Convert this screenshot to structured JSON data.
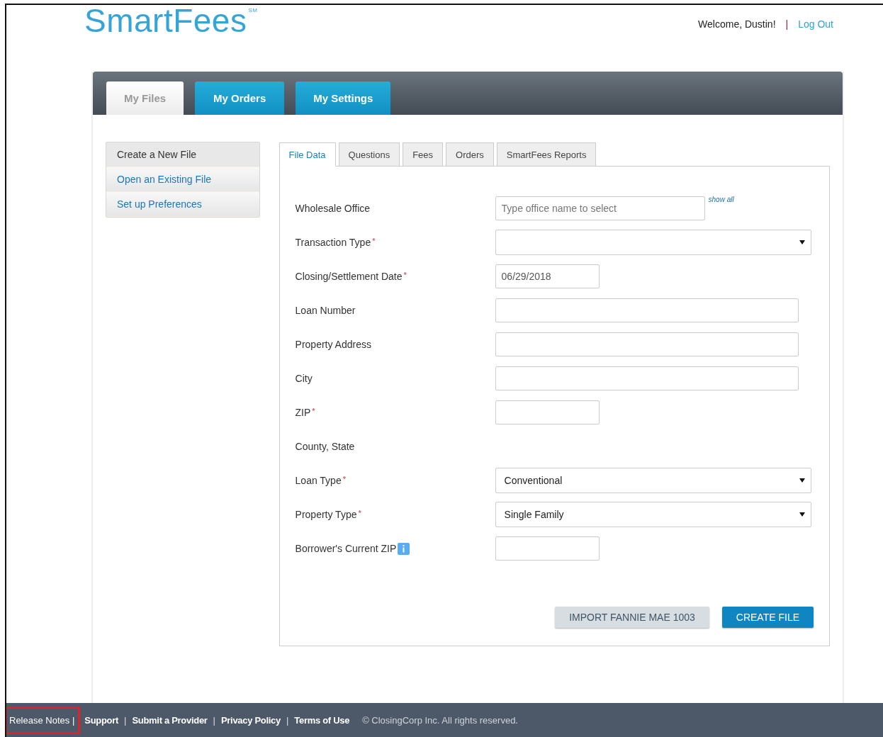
{
  "header": {
    "logo": "SmartFees",
    "logo_mark": "SM",
    "welcome": "Welcome, Dustin!",
    "separator": "|",
    "logout": "Log Out"
  },
  "main_tabs": [
    {
      "label": "My Files",
      "selected": true
    },
    {
      "label": "My Orders",
      "selected": false
    },
    {
      "label": "My Settings",
      "selected": false
    }
  ],
  "sidebar": {
    "items": [
      {
        "label": "Create a New File",
        "selected": true
      },
      {
        "label": "Open an Existing File",
        "selected": false
      },
      {
        "label": "Set up Preferences",
        "selected": false
      }
    ]
  },
  "sub_tabs": [
    {
      "label": "File Data",
      "selected": true
    },
    {
      "label": "Questions",
      "selected": false
    },
    {
      "label": "Fees",
      "selected": false
    },
    {
      "label": "Orders",
      "selected": false
    },
    {
      "label": "SmartFees Reports",
      "selected": false
    }
  ],
  "form": {
    "fields": [
      {
        "label": "Wholesale Office",
        "kind": "search",
        "placeholder": "Type office name to select",
        "link": "show all"
      },
      {
        "label": "Transaction Type",
        "required_mark": "*",
        "kind": "select"
      },
      {
        "label": "Closing/Settlement Date",
        "required_mark": "*",
        "kind": "date",
        "value": "06/29/2018"
      },
      {
        "label": "Loan Number",
        "kind": "text"
      },
      {
        "label": "Property Address",
        "kind": "text"
      },
      {
        "label": "City",
        "kind": "text"
      },
      {
        "label": "ZIP",
        "required_mark": "*",
        "kind": "zip"
      },
      {
        "label": "County, State",
        "kind": "static"
      },
      {
        "label": "Loan Type",
        "required_mark": "*",
        "kind": "select",
        "value": "Conventional"
      },
      {
        "label": "Property Type",
        "required_mark": "*",
        "kind": "select",
        "value": "Single Family"
      },
      {
        "label": "Borrower's Current ZIP",
        "kind": "zip",
        "info": true
      }
    ],
    "buttons": [
      {
        "label": "IMPORT FANNIE MAE 1003",
        "kind": "secondary"
      },
      {
        "label": "CREATE FILE",
        "kind": "primary"
      }
    ]
  },
  "footer": {
    "links": [
      {
        "label": "Release Notes",
        "highlighted": true
      },
      {
        "label": "Support",
        "highlighted": false
      },
      {
        "label": "Submit a Provider",
        "highlighted": false
      },
      {
        "label": "Privacy Policy",
        "highlighted": false
      },
      {
        "label": "Terms of Use",
        "highlighted": false
      }
    ],
    "separator": "|",
    "copyright": "© ClosingCorp Inc. All rights reserved."
  }
}
